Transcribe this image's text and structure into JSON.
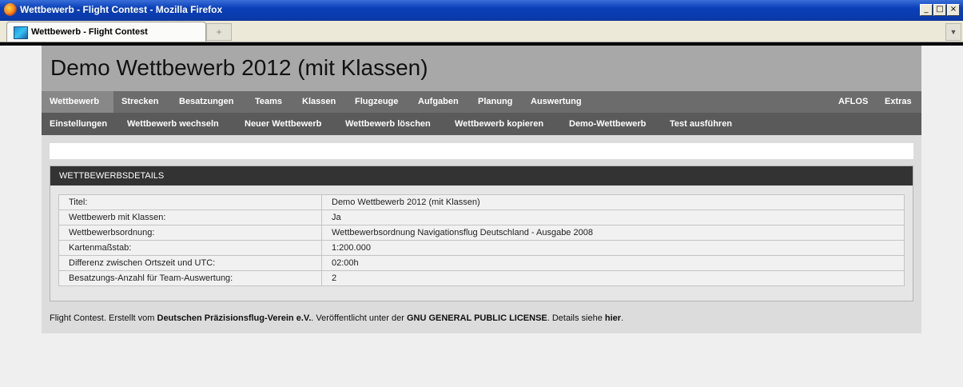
{
  "window": {
    "title": "Wettbewerb - Flight Contest - Mozilla Firefox"
  },
  "browser": {
    "tab_label": "Wettbewerb - Flight Contest"
  },
  "page": {
    "heading": "Demo Wettbewerb 2012 (mit Klassen)",
    "nav_primary": [
      "Wettbewerb",
      "Strecken",
      "Besatzungen",
      "Teams",
      "Klassen",
      "Flugzeuge",
      "Aufgaben",
      "Planung",
      "Auswertung"
    ],
    "nav_primary_right": [
      "AFLOS",
      "Extras"
    ],
    "nav_secondary": [
      "Einstellungen",
      "Wettbewerb wechseln",
      "Neuer Wettbewerb",
      "Wettbewerb löschen",
      "Wettbewerb kopieren",
      "Demo-Wettbewerb",
      "Test ausführen"
    ],
    "details": {
      "header": "WETTBEWERBSDETAILS",
      "rows": [
        {
          "key": "Titel:",
          "value": "Demo Wettbewerb 2012 (mit Klassen)"
        },
        {
          "key": "Wettbewerb mit Klassen:",
          "value": "Ja"
        },
        {
          "key": "Wettbewerbsordnung:",
          "value": "Wettbewerbsordnung Navigationsflug Deutschland - Ausgabe 2008"
        },
        {
          "key": "Kartenmaßstab:",
          "value": "1:200.000"
        },
        {
          "key": "Differenz zwischen Ortszeit und UTC:",
          "value": "02:00h"
        },
        {
          "key": "Besatzungs-Anzahl für Team-Auswertung:",
          "value": "2"
        }
      ]
    },
    "footer": {
      "t1": "Flight Contest. Erstellt vom ",
      "link1": "Deutschen Präzisionsflug-Verein e.V.",
      "t2": ". Veröffentlicht unter der ",
      "link2": "GNU GENERAL PUBLIC LICENSE",
      "t3": ". Details siehe ",
      "link3": "hier",
      "t4": "."
    }
  }
}
